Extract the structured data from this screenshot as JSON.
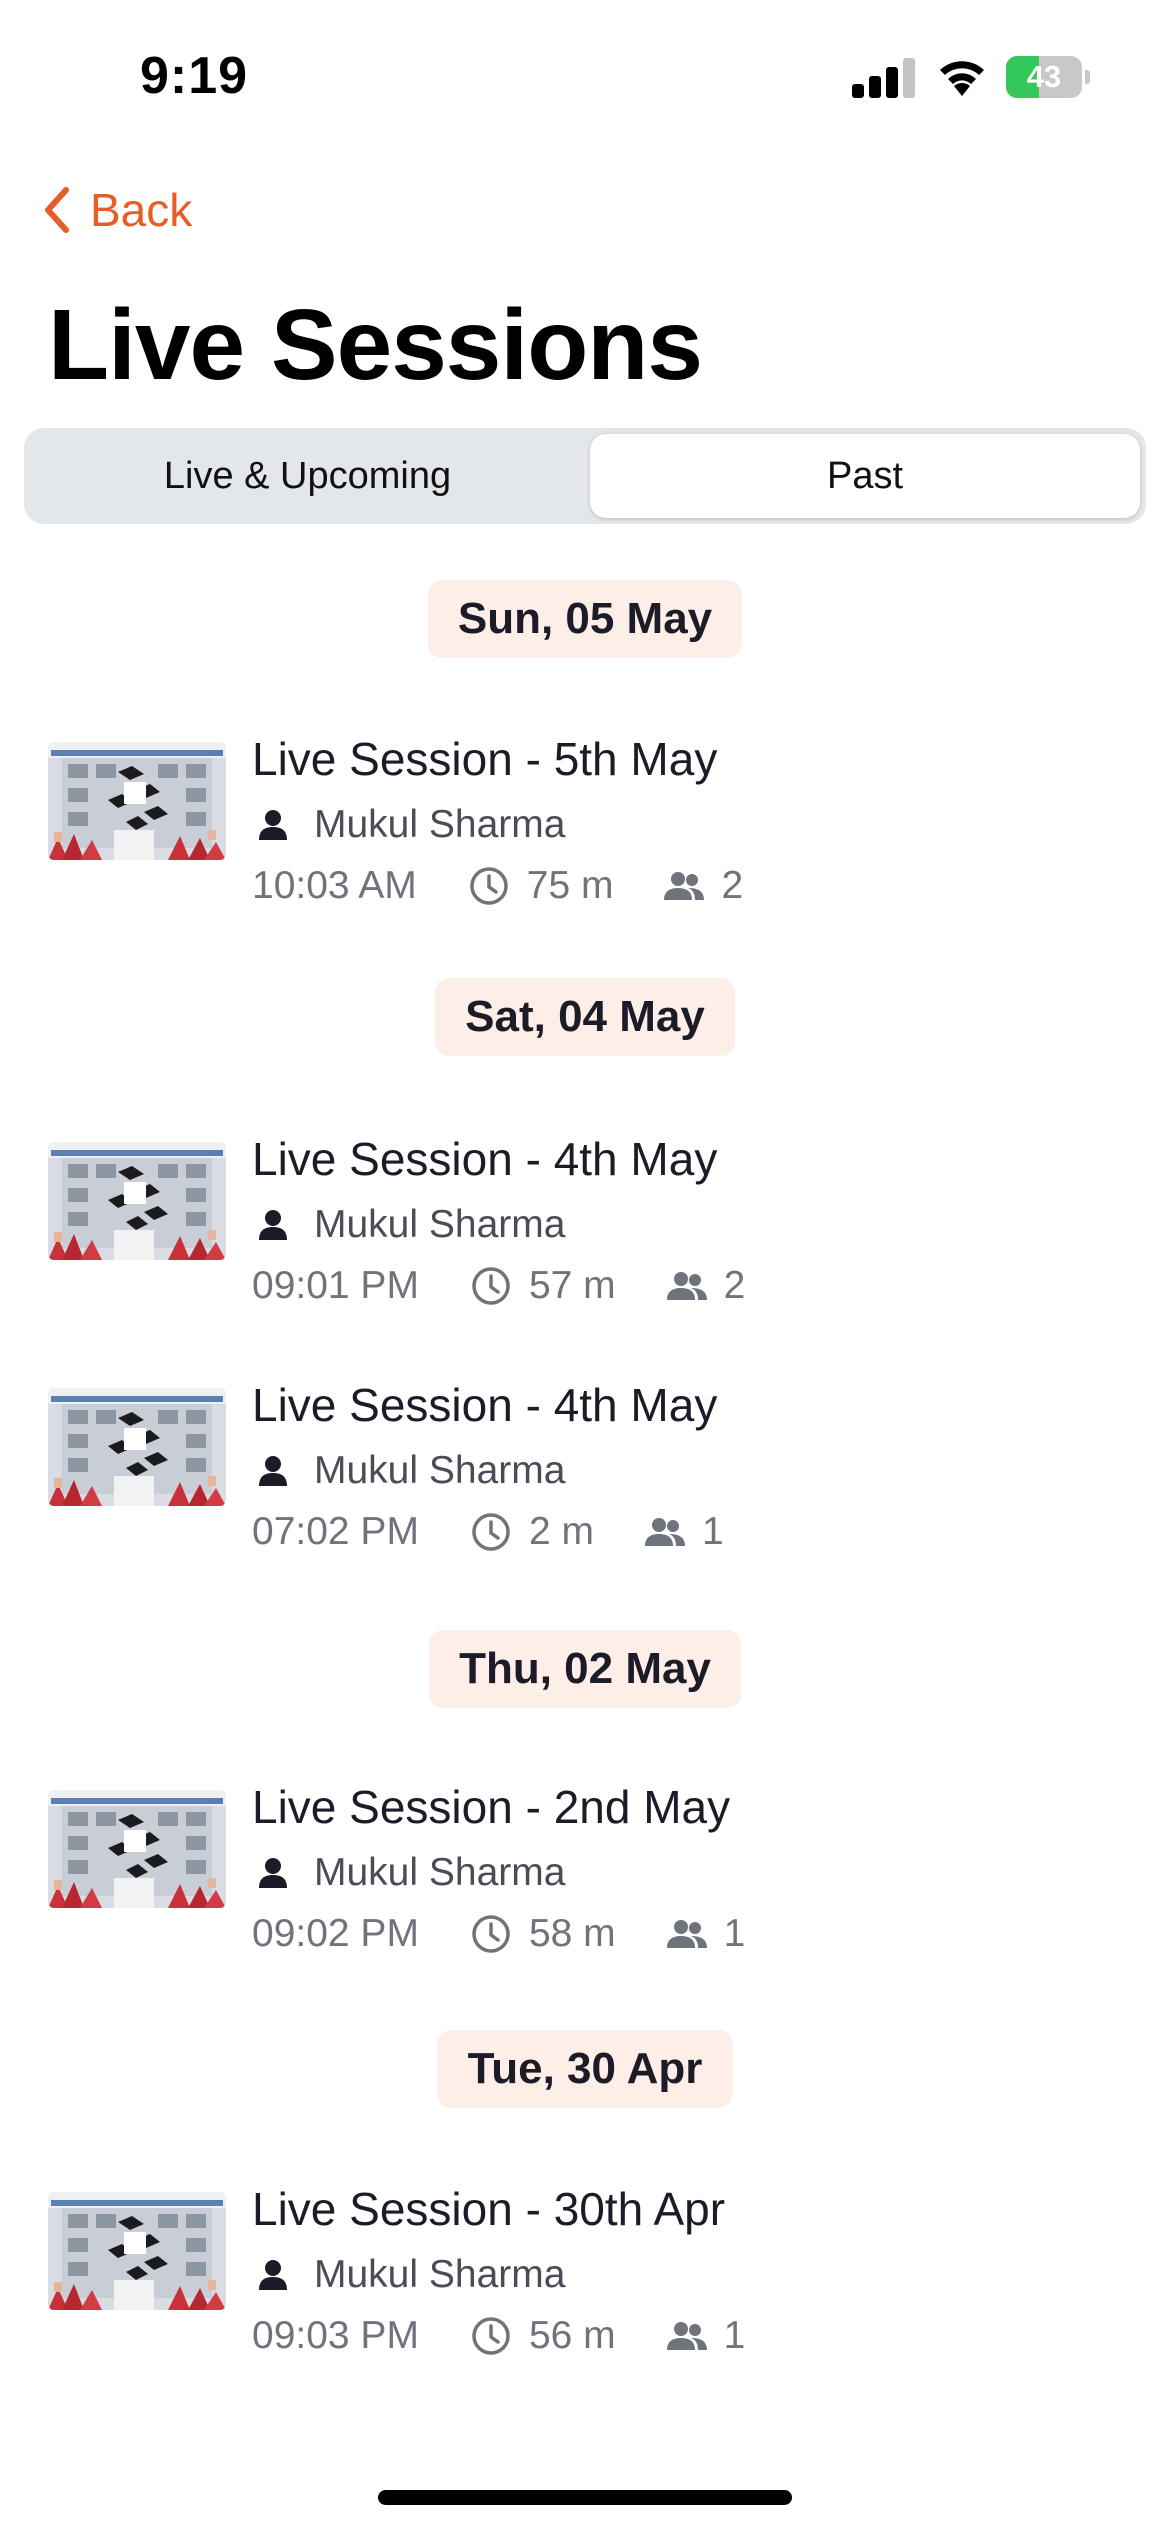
{
  "status_bar": {
    "time": "9:19",
    "battery_level": "43",
    "battery_fraction": 0.43,
    "battery_color": "#34c759",
    "icons": [
      "cellular-signal-icon",
      "wifi-icon",
      "battery-charging-icon"
    ]
  },
  "nav": {
    "back_label": "Back",
    "accent_color": "#e85d25"
  },
  "page": {
    "title": "Live Sessions"
  },
  "tabs": [
    {
      "label": "Live & Upcoming",
      "selected": false
    },
    {
      "label": "Past",
      "selected": true
    }
  ],
  "groups": [
    {
      "date": "Sun, 05 May",
      "sessions": [
        {
          "title": "Live Session - 5th May",
          "host": "Mukul Sharma",
          "time": "10:03 AM",
          "duration": "75 m",
          "attendees": "2"
        }
      ]
    },
    {
      "date": "Sat, 04 May",
      "sessions": [
        {
          "title": "Live Session - 4th May",
          "host": "Mukul Sharma",
          "time": "09:01 PM",
          "duration": "57 m",
          "attendees": "2"
        },
        {
          "title": "Live Session - 4th May",
          "host": "Mukul Sharma",
          "time": "07:02 PM",
          "duration": "2 m",
          "attendees": "1"
        }
      ]
    },
    {
      "date": "Thu, 02 May",
      "sessions": [
        {
          "title": "Live Session - 2nd May",
          "host": "Mukul Sharma",
          "time": "09:02 PM",
          "duration": "58 m",
          "attendees": "1"
        }
      ]
    },
    {
      "date": "Tue, 30 Apr",
      "sessions": [
        {
          "title": "Live Session - 30th Apr",
          "host": "Mukul Sharma",
          "time": "09:03 PM",
          "duration": "56 m",
          "attendees": "1"
        }
      ]
    }
  ]
}
